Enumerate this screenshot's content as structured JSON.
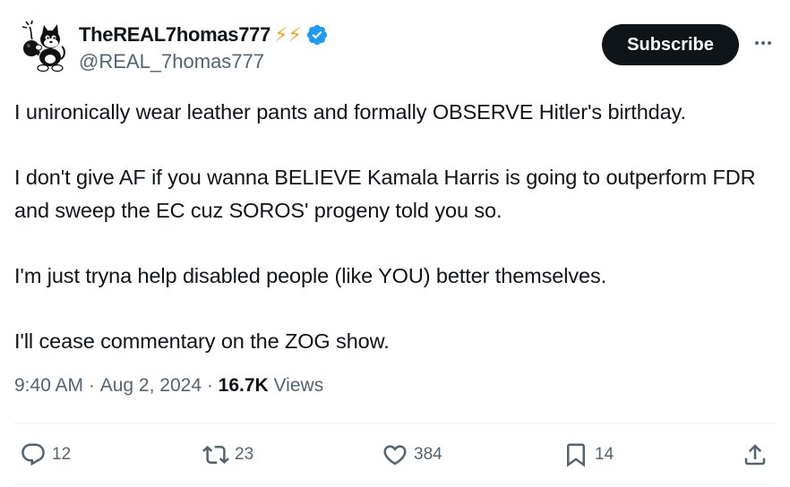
{
  "author": {
    "display_name": "TheREAL7homas777",
    "name_emoji": "⚡⚡",
    "handle": "@REAL_7homas777",
    "verified": true
  },
  "header": {
    "subscribe_label": "Subscribe",
    "more_icon": "more-horizontal-icon"
  },
  "tweet": {
    "paragraphs": [
      "I unironically wear leather pants and formally OBSERVE Hitler's birthday.",
      "I don't give AF if you wanna BELIEVE Kamala Harris is going to outperform FDR and sweep the EC cuz SOROS' progeny told you so.",
      "I'm just tryna help disabled people (like YOU) better themselves.",
      "I'll cease commentary on the ZOG show."
    ]
  },
  "meta": {
    "time": "9:40 AM",
    "separator": " · ",
    "date": "Aug 2, 2024",
    "views_count": "16.7K",
    "views_label": " Views"
  },
  "actions": {
    "replies": "12",
    "reposts": "23",
    "likes": "384",
    "bookmarks": "14"
  },
  "colors": {
    "text": "#0f1419",
    "secondary": "#536471",
    "verified": "#1d9bf0",
    "bolt": "#f4a623",
    "divider": "#eff3f4"
  }
}
